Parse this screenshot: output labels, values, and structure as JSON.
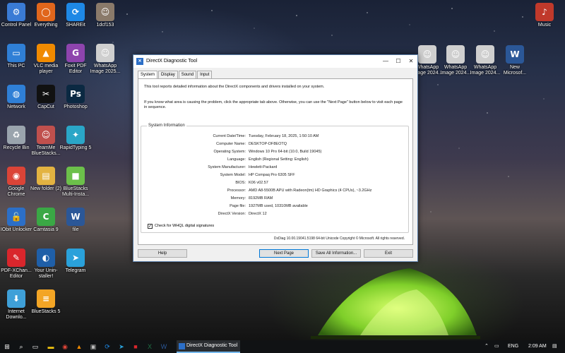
{
  "desktop": {
    "icons": [
      {
        "label": "Control Panel",
        "glyph": "⚙",
        "color": "#3a7bd5",
        "icon": "control-panel-icon"
      },
      {
        "label": "Everything",
        "glyph": "◯",
        "color": "#e0661c",
        "icon": "everything-search-icon"
      },
      {
        "label": "SHAREit",
        "glyph": "⟳",
        "color": "#1e88e5",
        "icon": "shareit-icon"
      },
      {
        "label": "1dcf153",
        "glyph": "☺",
        "color": "#8a7a6a",
        "icon": "photo-icon"
      },
      {
        "label": "Music",
        "glyph": "♪",
        "color": "#c0392b",
        "icon": "music-folder-icon"
      },
      {
        "label": "This PC",
        "glyph": "▭",
        "color": "#2f7fd6",
        "icon": "this-pc-icon"
      },
      {
        "label": "VLC media player",
        "glyph": "▲",
        "color": "#f08a00",
        "icon": "vlc-icon"
      },
      {
        "label": "Foxit PDF Editor",
        "glyph": "G",
        "color": "#8e44ad",
        "icon": "foxit-icon"
      },
      {
        "label": "WhatsApp Image 2025...",
        "glyph": "☺",
        "color": "#cfcfcf",
        "icon": "image-file-icon"
      },
      {
        "label": "Network",
        "glyph": "◍",
        "color": "#2f7fd6",
        "icon": "network-icon"
      },
      {
        "label": "CapCut",
        "glyph": "✂",
        "color": "#111111",
        "icon": "capcut-icon"
      },
      {
        "label": "Photoshop",
        "glyph": "Ps",
        "color": "#0b2942",
        "icon": "photoshop-icon"
      },
      {
        "label": "Recycle Bin",
        "glyph": "♻",
        "color": "#9aa4ad",
        "icon": "recycle-bin-icon"
      },
      {
        "label": "TeamMe BlueStacks...",
        "glyph": "☺",
        "color": "#c0504d",
        "icon": "image-file-icon"
      },
      {
        "label": "RapidTyping 5",
        "glyph": "✦",
        "color": "#2aa6c7",
        "icon": "rapidtyping-icon"
      },
      {
        "label": "Google Chrome",
        "glyph": "◉",
        "color": "#db4437",
        "icon": "chrome-icon"
      },
      {
        "label": "New folder (2)",
        "glyph": "▤",
        "color": "#e3b341",
        "icon": "folder-icon"
      },
      {
        "label": "BlueStacks Multi-Insta...",
        "glyph": "■",
        "color": "#6cc04a",
        "icon": "bluestacks-multi-icon"
      },
      {
        "label": "IObit Unlocker",
        "glyph": "🔓",
        "color": "#2c6fc7",
        "icon": "unlocker-icon"
      },
      {
        "label": "Camtasia 9",
        "glyph": "C",
        "color": "#3aa845",
        "icon": "camtasia-icon"
      },
      {
        "label": "file",
        "glyph": "W",
        "color": "#2b5797",
        "icon": "word-file-icon"
      },
      {
        "label": "PDF-XChan... Editor",
        "glyph": "✎",
        "color": "#d9262c",
        "icon": "pdf-xchange-icon"
      },
      {
        "label": "Your Unin-staller!",
        "glyph": "◐",
        "color": "#1f5fa8",
        "icon": "uninstaller-icon"
      },
      {
        "label": "Telegram",
        "glyph": "➤",
        "color": "#2aa1da",
        "icon": "telegram-icon"
      },
      {
        "label": "Internet Downlo...",
        "glyph": "⬇",
        "color": "#3fa0d8",
        "icon": "idm-icon"
      },
      {
        "label": "BlueStacks 5",
        "glyph": "≡",
        "color": "#f3a525",
        "icon": "bluestacks-icon"
      },
      {
        "label": "WhatsApp Image 2024...",
        "glyph": "☺",
        "color": "#cfcfcf",
        "icon": "image-file-icon"
      },
      {
        "label": "WhatsApp Image 2024...",
        "glyph": "☺",
        "color": "#cfcfcf",
        "icon": "image-file-icon"
      },
      {
        "label": "WhatsApp Image 2024...",
        "glyph": "☺",
        "color": "#cfcfcf",
        "icon": "image-file-icon"
      },
      {
        "label": "New Microsof...",
        "glyph": "W",
        "color": "#2b5797",
        "icon": "word-file-icon"
      }
    ]
  },
  "dialog": {
    "title": "DirectX Diagnostic Tool",
    "tabs": [
      "System",
      "Display",
      "Sound",
      "Input"
    ],
    "intro1": "This tool reports detailed information about the DirectX components and drivers installed on your system.",
    "intro2": "If you know what area is causing the problem, click the appropriate tab above.  Otherwise, you can use the \"Next Page\" button below to visit each page in sequence.",
    "group_title": "System Information",
    "rows": [
      {
        "label": "Current Date/Time:",
        "value": "Tuesday, February 18, 2025, 1:50:10 AM"
      },
      {
        "label": "Computer Name:",
        "value": "DESKTOP-DF8EOTQ"
      },
      {
        "label": "Operating System:",
        "value": "Windows 10 Pro 64-bit (10.0, Build 19045)"
      },
      {
        "label": "Language:",
        "value": "English (Regional Setting: English)"
      },
      {
        "label": "System Manufacturer:",
        "value": "Hewlett-Packard"
      },
      {
        "label": "System Model:",
        "value": "HP Compaq Pro 6305 SFF"
      },
      {
        "label": "BIOS:",
        "value": "K06 v02.57"
      },
      {
        "label": "Processor:",
        "value": "AMD A8-5500B APU with Radeon(tm) HD Graphics    (4 CPUs), ~3.2GHz"
      },
      {
        "label": "Memory:",
        "value": "8192MB RAM"
      },
      {
        "label": "Page file:",
        "value": "1927MB used, 10310MB available"
      },
      {
        "label": "DirectX Version:",
        "value": "DirectX 12"
      }
    ],
    "whql_label": "Check for WHQL digital signatures",
    "footer": "DxDiag 10.00.19041.5198 64-bit Unicode  Copyright © Microsoft. All rights reserved.",
    "buttons": {
      "help": "Help",
      "next": "Next Page",
      "save": "Save All Information...",
      "exit": "Exit"
    }
  },
  "taskbar": {
    "active_app": "DirectX Diagnostic Tool",
    "language": "ENG",
    "time": "2:09 AM"
  }
}
